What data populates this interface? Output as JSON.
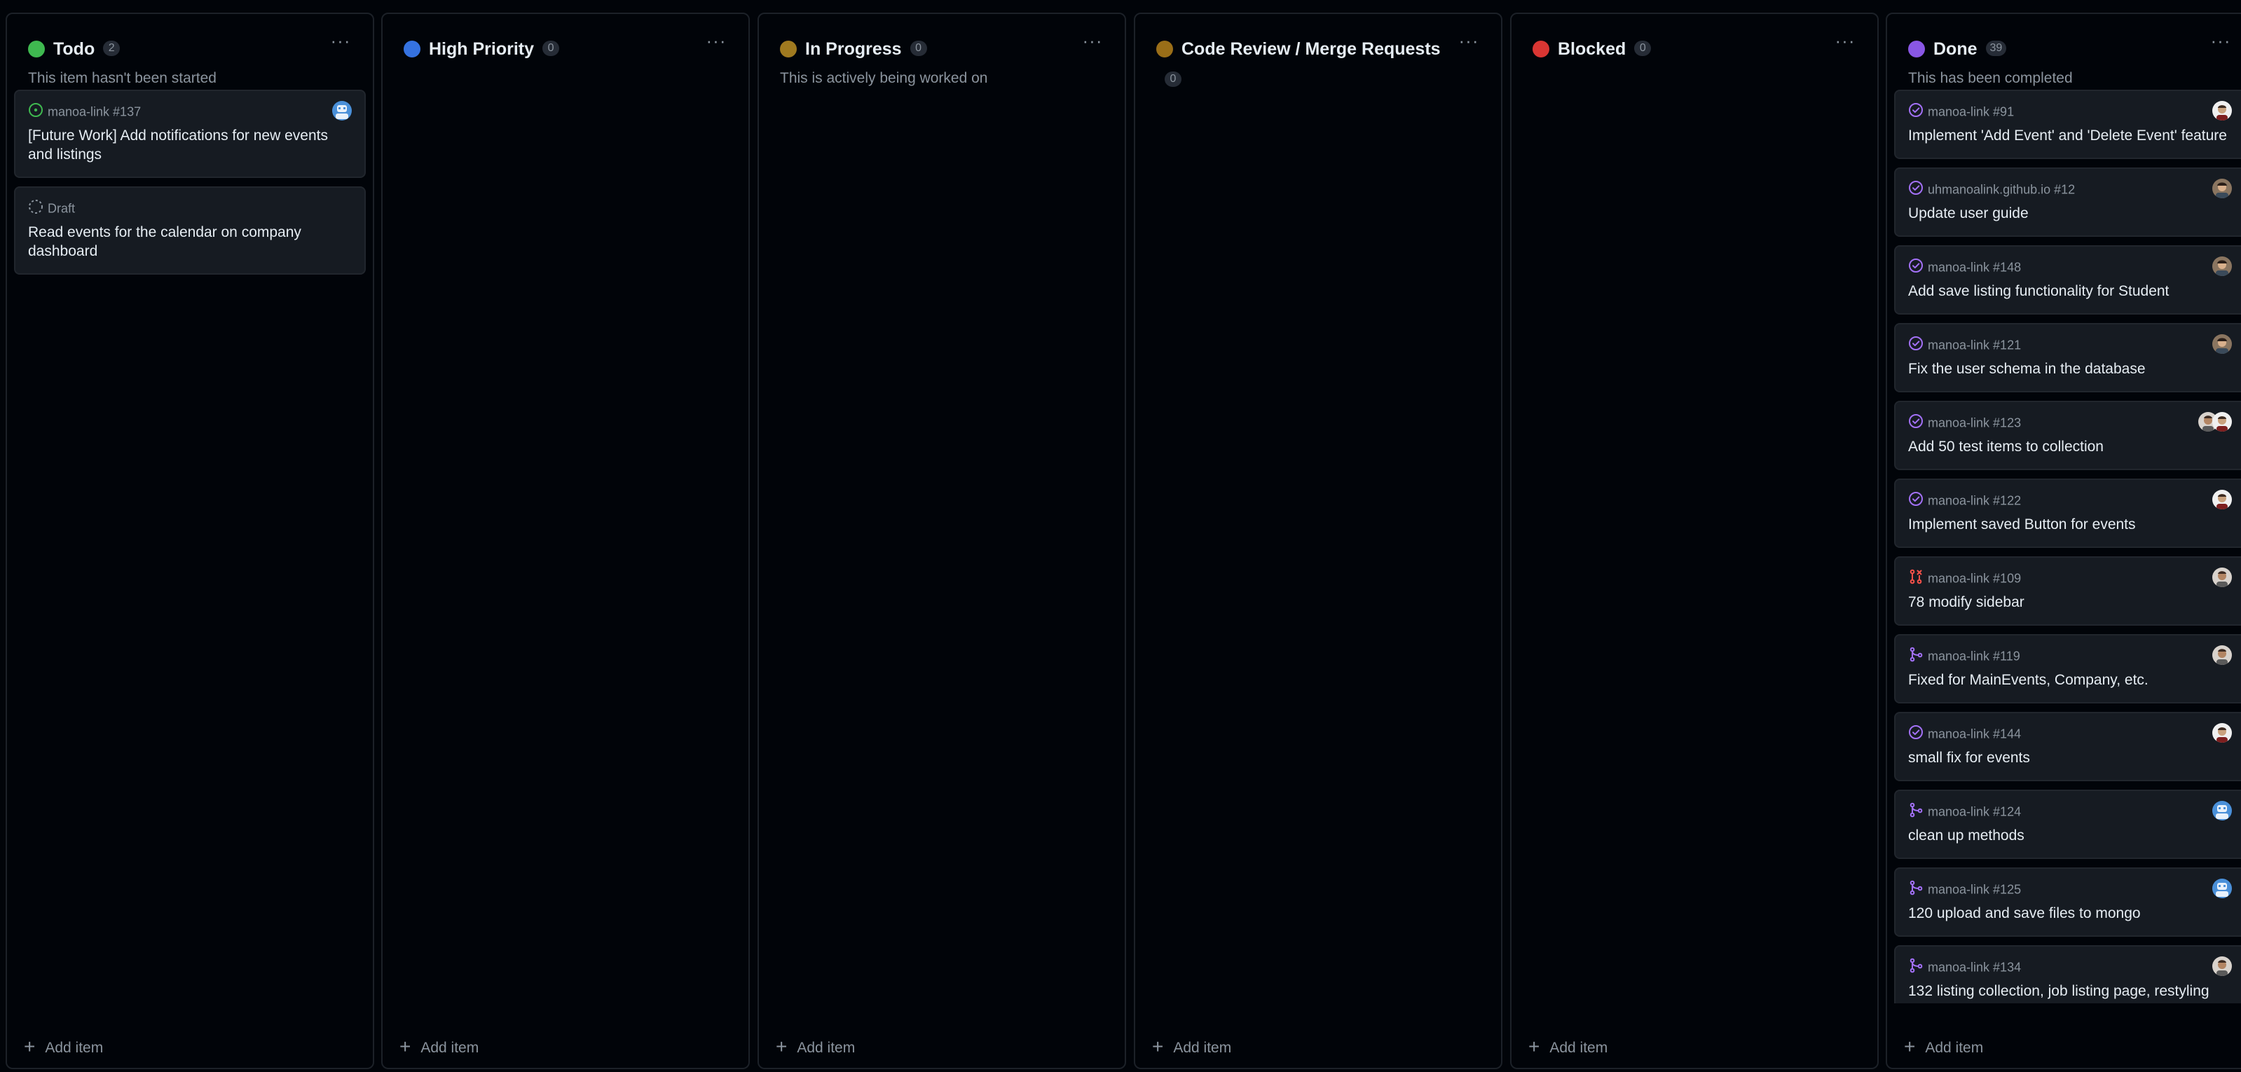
{
  "colors": {
    "todo": "#3fb950",
    "high_priority": "#3572e0",
    "in_progress": "#a07a20",
    "code_review": "#9a6e18",
    "blocked": "#da3633",
    "done": "#8957e5",
    "open_issue": "#3fb950",
    "closed_issue": "#a371f7",
    "closed_pr": "#f85149",
    "merged_pr": "#a371f7"
  },
  "add_item_label": "Add item",
  "menu_glyph": "···",
  "columns": [
    {
      "title": "Todo",
      "count": "2",
      "description": "This item hasn't been started",
      "cards": [
        {
          "ref": "manoa-link #137",
          "title": "[Future Work] Add notifications for new events and listings",
          "icon": "open-issue-icon",
          "avatar": "avatar-blue"
        },
        {
          "ref": "Draft",
          "title": "Read events for the calendar on company dashboard",
          "icon": "draft-icon",
          "avatar": ""
        }
      ]
    },
    {
      "title": "High Priority",
      "count": "0",
      "description": "",
      "cards": []
    },
    {
      "title": "In Progress",
      "count": "0",
      "description": "This is actively being worked on",
      "cards": []
    },
    {
      "title": "Code Review / Merge Requests",
      "count": "0",
      "description": "",
      "cards": []
    },
    {
      "title": "Blocked",
      "count": "0",
      "description": "",
      "cards": []
    },
    {
      "title": "Done",
      "count": "39",
      "description": "This has been completed",
      "cards": [
        {
          "ref": "manoa-link #91",
          "title": "Implement 'Add Event' and 'Delete Event' feature",
          "icon": "closed-issue-icon",
          "avatar": "avatar-white"
        },
        {
          "ref": "uhmanoalink.github.io #12",
          "title": "Update user guide",
          "icon": "closed-issue-icon",
          "avatar": "avatar-photo"
        },
        {
          "ref": "manoa-link #148",
          "title": "Add save listing functionality for Student",
          "icon": "closed-issue-icon",
          "avatar": "avatar-photo"
        },
        {
          "ref": "manoa-link #121",
          "title": "Fix the user schema in the database",
          "icon": "closed-issue-icon",
          "avatar": "avatar-photo"
        },
        {
          "ref": "manoa-link #123",
          "title": "Add 50 test items to collection",
          "icon": "closed-issue-icon",
          "avatar": "avatar-pair"
        },
        {
          "ref": "manoa-link #122",
          "title": "Implement saved Button for events",
          "icon": "closed-issue-icon",
          "avatar": "avatar-white"
        },
        {
          "ref": "manoa-link #109",
          "title": "78 modify sidebar",
          "icon": "closed-pr-icon",
          "avatar": "avatar-face"
        },
        {
          "ref": "manoa-link #119",
          "title": "Fixed for MainEvents, Company, etc.",
          "icon": "merged-pr-icon",
          "avatar": "avatar-face"
        },
        {
          "ref": "manoa-link #144",
          "title": "small fix for events",
          "icon": "closed-issue-icon",
          "avatar": "avatar-white"
        },
        {
          "ref": "manoa-link #124",
          "title": "clean up methods",
          "icon": "merged-pr-icon",
          "avatar": "avatar-blue"
        },
        {
          "ref": "manoa-link #125",
          "title": "120 upload and save files to mongo",
          "icon": "merged-pr-icon",
          "avatar": "avatar-blue"
        },
        {
          "ref": "manoa-link #134",
          "title": "132 listing collection, job listing page, restyling",
          "icon": "merged-pr-icon",
          "avatar": "avatar-face"
        }
      ]
    }
  ]
}
